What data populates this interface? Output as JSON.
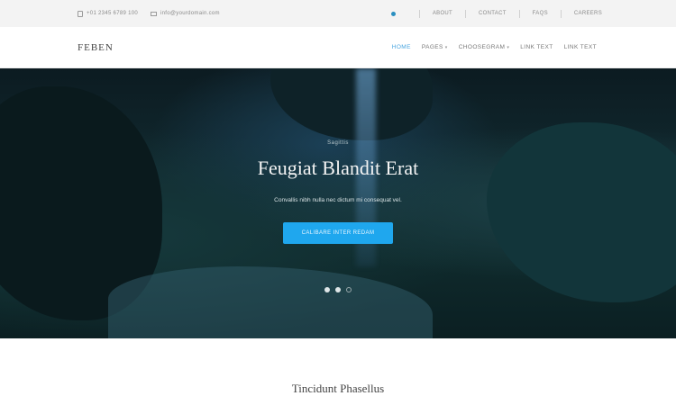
{
  "topbar": {
    "phone": "+01 2345 6789 100",
    "email": "info@yourdomain.com",
    "links": [
      "ABOUT",
      "CONTACT",
      "FAQS",
      "CAREERS"
    ]
  },
  "navbar": {
    "logo": "FEBEN",
    "menu": [
      {
        "label": "HOME",
        "active": true,
        "dropdown": false
      },
      {
        "label": "PAGES",
        "active": false,
        "dropdown": true
      },
      {
        "label": "CHOOSEGRAM",
        "active": false,
        "dropdown": true
      },
      {
        "label": "LINK TEXT",
        "active": false,
        "dropdown": false
      },
      {
        "label": "LINK TEXT",
        "active": false,
        "dropdown": false
      }
    ]
  },
  "hero": {
    "eyebrow": "Sagittis",
    "headline": "Feugiat Blandit Erat",
    "subtext": "Convallis nibh nulla nec dictum mi consequat vel.",
    "cta_label": "CALIBARE INTER REDAM",
    "slides_total": 3,
    "slide_active": 2
  },
  "section": {
    "title": "Tincidunt Phasellus"
  },
  "colors": {
    "accent": "#1fa7ee",
    "nav_active": "#4aa6e0",
    "topbar_bg": "#f3f3f3",
    "hero_bg": "#0f2a2c"
  }
}
